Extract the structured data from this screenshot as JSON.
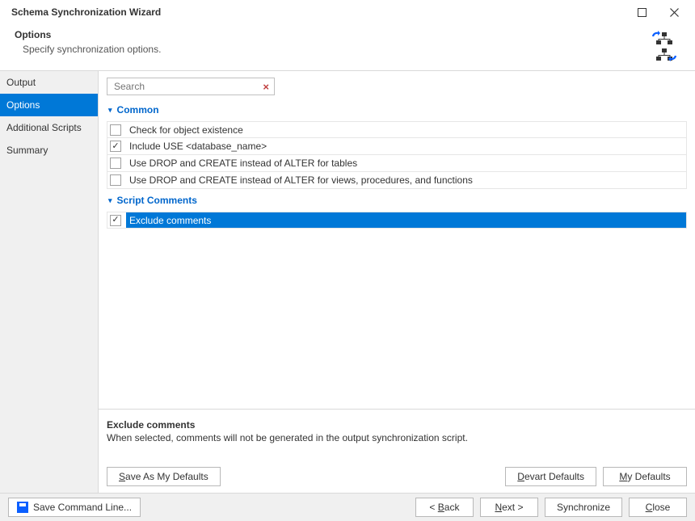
{
  "window": {
    "title": "Schema Synchronization Wizard"
  },
  "header": {
    "title": "Options",
    "subtitle": "Specify synchronization options."
  },
  "sidebar": {
    "items": [
      {
        "label": "Output",
        "active": false
      },
      {
        "label": "Options",
        "active": true
      },
      {
        "label": "Additional Scripts",
        "active": false
      },
      {
        "label": "Summary",
        "active": false
      }
    ]
  },
  "search": {
    "placeholder": "Search"
  },
  "sections": [
    {
      "title": "Common",
      "options": [
        {
          "label": "Check for object existence",
          "checked": false,
          "selected": false
        },
        {
          "label": "Include USE <database_name>",
          "checked": true,
          "selected": false
        },
        {
          "label": "Use DROP and CREATE instead of ALTER for tables",
          "checked": false,
          "selected": false
        },
        {
          "label": "Use DROP and CREATE instead of ALTER for views, procedures, and functions",
          "checked": false,
          "selected": false
        }
      ]
    },
    {
      "title": "Script Comments",
      "options": [
        {
          "label": "Exclude comments",
          "checked": true,
          "selected": true
        }
      ]
    }
  ],
  "description": {
    "title": "Exclude comments",
    "text": "When selected, comments will not be generated in the output synchronization script."
  },
  "buttons": {
    "save_defaults": "Save As My Defaults",
    "devart_defaults": "Devart Defaults",
    "my_defaults": "My Defaults",
    "save_cmd": "Save Command Line...",
    "back": "< Back",
    "next": "Next >",
    "synchronize": "Synchronize",
    "close": "Close"
  },
  "mnemonics": {
    "save_defaults": "S",
    "devart_defaults": "D",
    "my_defaults": "M",
    "back": "B",
    "next": "N",
    "close": "C"
  }
}
